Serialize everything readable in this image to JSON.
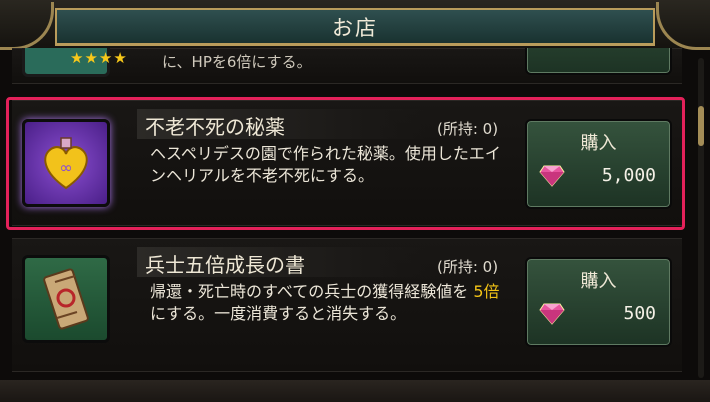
{
  "header": {
    "title": "お店"
  },
  "prev_item": {
    "desc_tail": "に、HPを6倍にする。",
    "stars": "★★★★"
  },
  "items": [
    {
      "name": "不老不死の秘薬",
      "owned": "(所持: 0)",
      "desc": "ヘスペリデスの園で作られた秘薬。使用したエインヘリアルを不老不死にする。",
      "buy_label": "購入",
      "price": "5,000",
      "icon": "heart-potion-icon",
      "selected": true
    },
    {
      "name": "兵士五倍成長の書",
      "owned": "(所持: 0)",
      "desc_before": "帰還・死亡時のすべての兵士の獲得経験値を ",
      "desc_highlight": "5倍",
      "desc_after": " にする。一度消費すると消失する。",
      "buy_label": "購入",
      "price": "500",
      "icon": "scroll-icon",
      "selected": false
    }
  ],
  "colors": {
    "highlight_border": "#e3215a",
    "button_green": "#35533d",
    "accent_gold": "#f2c316"
  }
}
